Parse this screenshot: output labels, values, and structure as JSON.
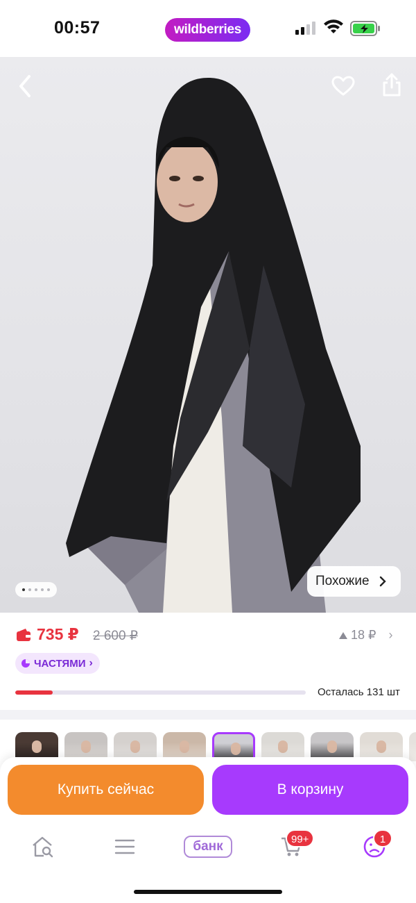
{
  "status_bar": {
    "time": "00:57",
    "brand": "wildberries"
  },
  "hero": {
    "image_description_icon": "product-photo",
    "gallery": {
      "total": 5,
      "active_index": 0
    },
    "similar_label": "Похожие"
  },
  "price": {
    "current": "735 ₽",
    "old": "2 600 ₽",
    "delta": "18 ₽",
    "parts_label": "ЧАСТЯМИ",
    "stock_text": "Осталась 131 шт",
    "stock_fraction": 0.13
  },
  "thumbnails": {
    "count": 9,
    "selected_index": 4
  },
  "actions": {
    "buy_now": "Купить сейчас",
    "add_to_cart": "В корзину"
  },
  "nav": {
    "bank_label": "банк",
    "cart_badge": "99+",
    "profile_badge": "1"
  },
  "colors": {
    "price_red": "#e8333f",
    "buy_orange": "#f38b2d",
    "cart_purple": "#a73afd",
    "brand_gradient_start": "#c21cc2",
    "brand_gradient_end": "#7b2cf2"
  }
}
